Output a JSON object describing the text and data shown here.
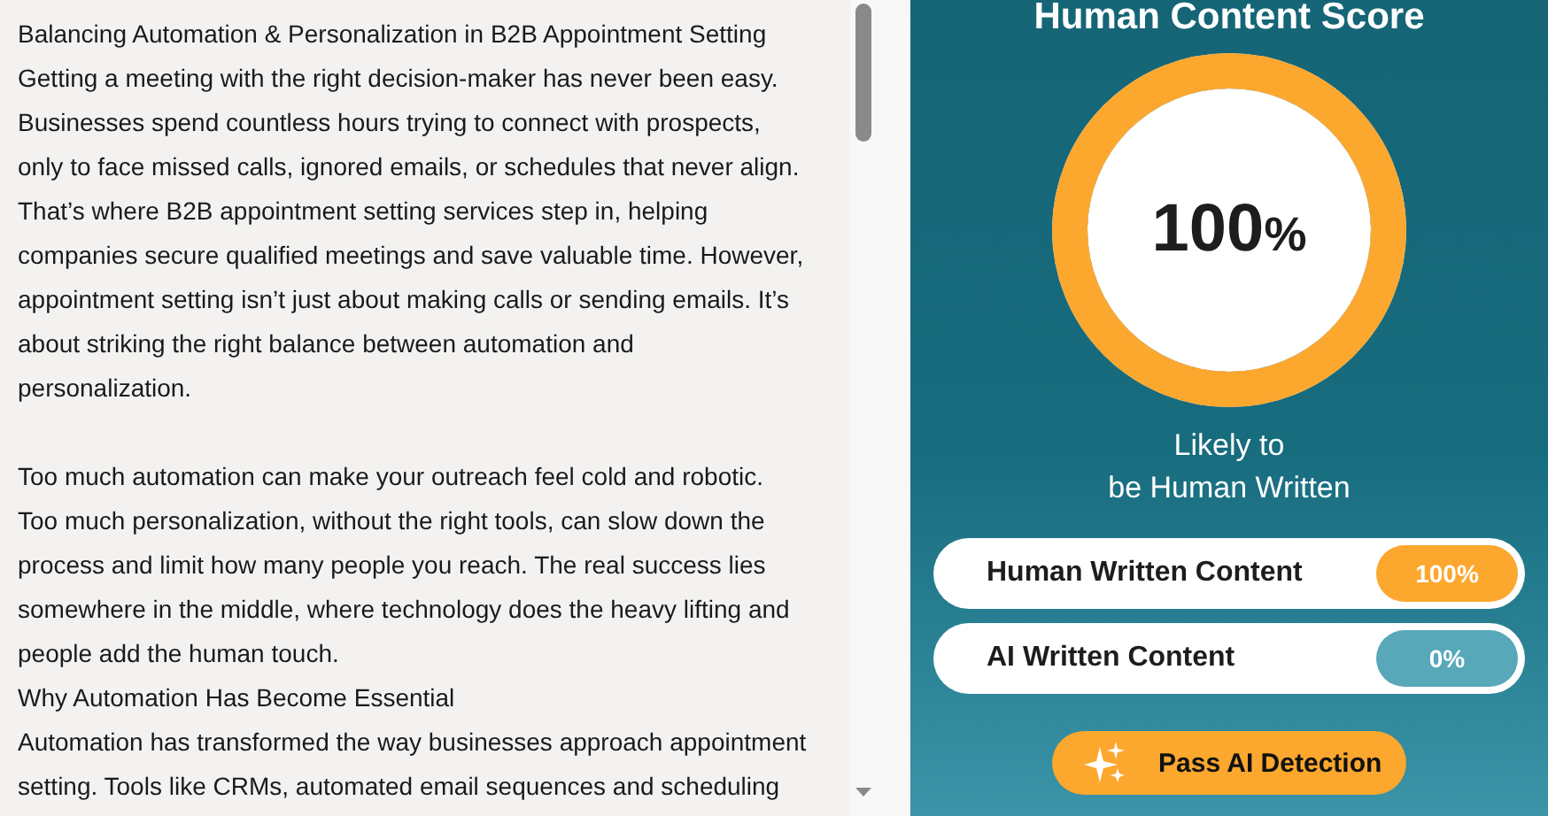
{
  "editor": {
    "sections": [
      {
        "lines": [
          "Balancing Automation & Personalization in B2B Appointment Setting",
          "Getting a meeting with the right decision-maker has never been easy.",
          "Businesses spend countless hours trying to connect with prospects,",
          "only to face missed calls, ignored emails, or schedules that never align.",
          "That’s where B2B appointment setting services step in, helping",
          "companies secure qualified meetings and save valuable time. However,",
          "appointment setting isn’t just about making calls or sending emails. It’s",
          "about striking the right balance between automation and",
          "personalization."
        ]
      },
      {
        "lines": [
          "Too much automation can make your outreach feel cold and robotic.",
          "Too much personalization, without the right tools, can slow down the",
          "process and limit how many people you reach. The real success lies",
          "somewhere in the middle, where technology does the heavy lifting and",
          "people add the human touch.",
          "Why Automation Has Become Essential",
          "Automation has transformed the way businesses approach appointment",
          "setting. Tools like CRMs, automated email sequences and scheduling"
        ]
      }
    ]
  },
  "score": {
    "title": "Human Content Score",
    "value": "100",
    "unit": "%",
    "level": 1,
    "caption": [
      "Likely to",
      "be Human Written"
    ]
  },
  "results": [
    {
      "label": "Human Written Content",
      "value": "100%",
      "kind": "human"
    },
    {
      "label": "AI Written Content",
      "value": "0%",
      "kind": "ai"
    }
  ],
  "action": {
    "label": "Pass AI Detection"
  }
}
